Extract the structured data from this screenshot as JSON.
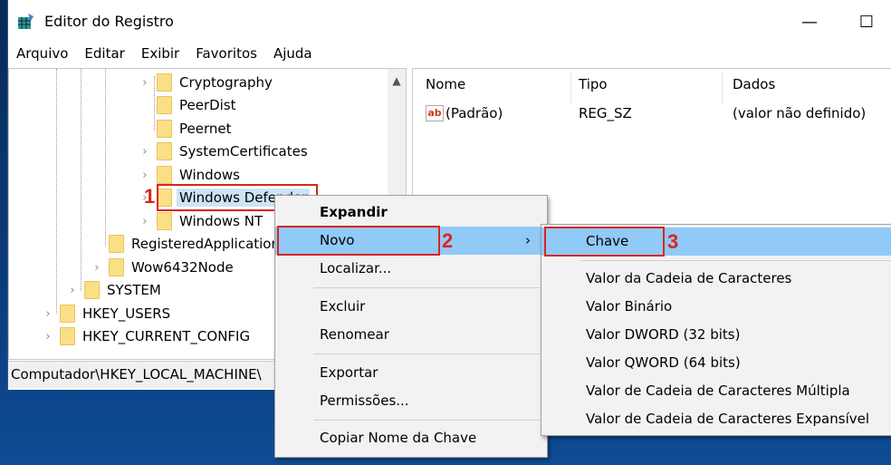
{
  "window": {
    "title": "Editor do Registro",
    "minimize_icon": "—",
    "maximize_icon": "☐"
  },
  "menubar": [
    "Arquivo",
    "Editar",
    "Exibir",
    "Favoritos",
    "Ajuda"
  ],
  "tree": [
    {
      "label": "Cryptography",
      "expandable": true
    },
    {
      "label": "PeerDist",
      "expandable": false
    },
    {
      "label": "Peernet",
      "expandable": false
    },
    {
      "label": "SystemCertificates",
      "expandable": true
    },
    {
      "label": "Windows",
      "expandable": true
    },
    {
      "label": "Windows Defender",
      "expandable": true,
      "selected": true
    },
    {
      "label": "Windows NT",
      "expandable": true
    },
    {
      "label": "RegisteredApplications",
      "expandable": false
    },
    {
      "label": "Wow6432Node",
      "expandable": true
    },
    {
      "label": "SYSTEM",
      "expandable": true
    },
    {
      "label": "HKEY_USERS",
      "expandable": true
    },
    {
      "label": "HKEY_CURRENT_CONFIG",
      "expandable": true
    }
  ],
  "list": {
    "columns": [
      "Nome",
      "Tipo",
      "Dados"
    ],
    "rows": [
      {
        "name": "(Padrão)",
        "type": "REG_SZ",
        "data": "(valor não definido)",
        "icon": "ab"
      }
    ]
  },
  "status": "Computador\\HKEY_LOCAL_MACHINE\\",
  "context_menu": [
    "Expandir",
    "Novo",
    "Localizar...",
    "Excluir",
    "Renomear",
    "Exportar",
    "Permissões...",
    "Copiar Nome da Chave"
  ],
  "submenu": [
    "Chave",
    "Valor da Cadeia de Caracteres",
    "Valor Binário",
    "Valor DWORD (32 bits)",
    "Valor QWORD (64 bits)",
    "Valor de Cadeia de Caracteres Múltipla",
    "Valor de Cadeia de Caracteres Expansível"
  ],
  "annotations": [
    "1",
    "2",
    "3"
  ],
  "colors": {
    "highlight": "#91c9f7",
    "annotation": "#d9261c",
    "folder": "#fbdf86"
  }
}
